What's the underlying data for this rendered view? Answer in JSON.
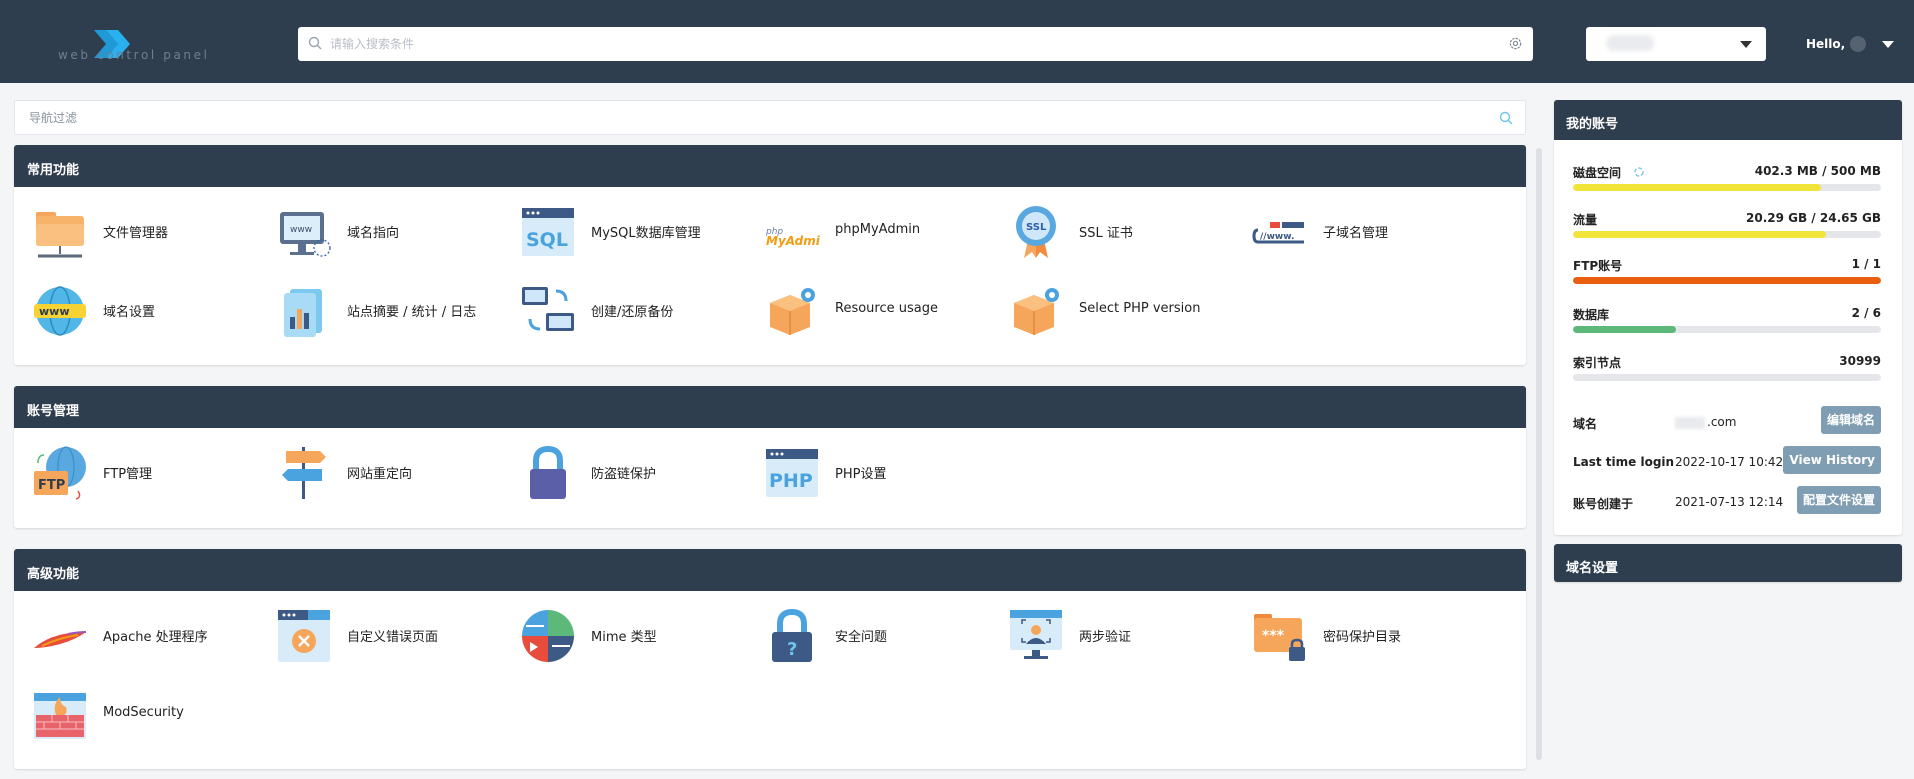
{
  "header": {
    "search_placeholder": "请输入搜索条件",
    "hello": "Hello,",
    "logo_subtitle": "web control panel"
  },
  "nav_filter": {
    "placeholder": "导航过滤"
  },
  "sections": [
    {
      "title": "常用功能",
      "items": [
        {
          "label": "文件管理器",
          "icon": "folder-network-icon"
        },
        {
          "label": "域名指向",
          "icon": "domain-pointer-icon"
        },
        {
          "label": "MySQL数据库管理",
          "icon": "sql-window-icon"
        },
        {
          "label": "phpMyAdmin",
          "icon": "phpmyadmin-logo-icon"
        },
        {
          "label": "SSL 证书",
          "icon": "ssl-badge-icon"
        },
        {
          "label": "子域名管理",
          "icon": "subdomain-icon"
        },
        {
          "label": "域名设置",
          "icon": "www-globe-icon"
        },
        {
          "label": "站点摘要 / 统计 / 日志",
          "icon": "stats-chart-icon"
        },
        {
          "label": "创建/还原备份",
          "icon": "backup-computers-icon"
        },
        {
          "label": "Resource usage",
          "icon": "box-gear-icon"
        },
        {
          "label": "Select PHP version",
          "icon": "box-gear-icon"
        }
      ]
    },
    {
      "title": "账号管理",
      "items": [
        {
          "label": "FTP管理",
          "icon": "ftp-globe-icon"
        },
        {
          "label": "网站重定向",
          "icon": "signpost-icon"
        },
        {
          "label": "防盗链保护",
          "icon": "lock-icon"
        },
        {
          "label": "PHP设置",
          "icon": "php-window-icon"
        }
      ]
    },
    {
      "title": "高级功能",
      "items": [
        {
          "label": "Apache 处理程序",
          "icon": "apache-feather-icon"
        },
        {
          "label": "自定义错误页面",
          "icon": "error-page-icon"
        },
        {
          "label": "Mime 类型",
          "icon": "mime-types-icon"
        },
        {
          "label": "安全问题",
          "icon": "question-lock-icon"
        },
        {
          "label": "两步验证",
          "icon": "two-step-verify-icon"
        },
        {
          "label": "密码保护目录",
          "icon": "password-folder-icon"
        },
        {
          "label": "ModSecurity",
          "icon": "firewall-icon"
        }
      ]
    }
  ],
  "account": {
    "title": "我的账号",
    "stats": [
      {
        "name": "磁盘空间",
        "value": "402.3 MB / 500 MB",
        "fraction": 0.805,
        "color": "#f2e53a"
      },
      {
        "name": "流量",
        "value": "20.29 GB / 24.65 GB",
        "fraction": 0.823,
        "color": "#f2e53a"
      },
      {
        "name": "FTP账号",
        "value": "1 / 1",
        "fraction": 1.0,
        "color": "#e95d0f"
      },
      {
        "name": "数据库",
        "value": "2 / 6",
        "fraction": 0.333,
        "color": "#5cb97a"
      },
      {
        "name": "索引节点",
        "value": "30999",
        "fraction": 0,
        "color": "#e4e6e9"
      }
    ],
    "domain_label": "域名",
    "domain_value": ".com",
    "edit_domain_button": "编辑域名",
    "last_login_label": "Last time login",
    "last_login_value": "2022-10-17 10:42",
    "view_history_button": "View History",
    "created_label": "账号创建于",
    "created_value": "2021-07-13 12:14",
    "config_button": "配置文件设置"
  },
  "domain_settings_card": {
    "title": "域名设置"
  }
}
